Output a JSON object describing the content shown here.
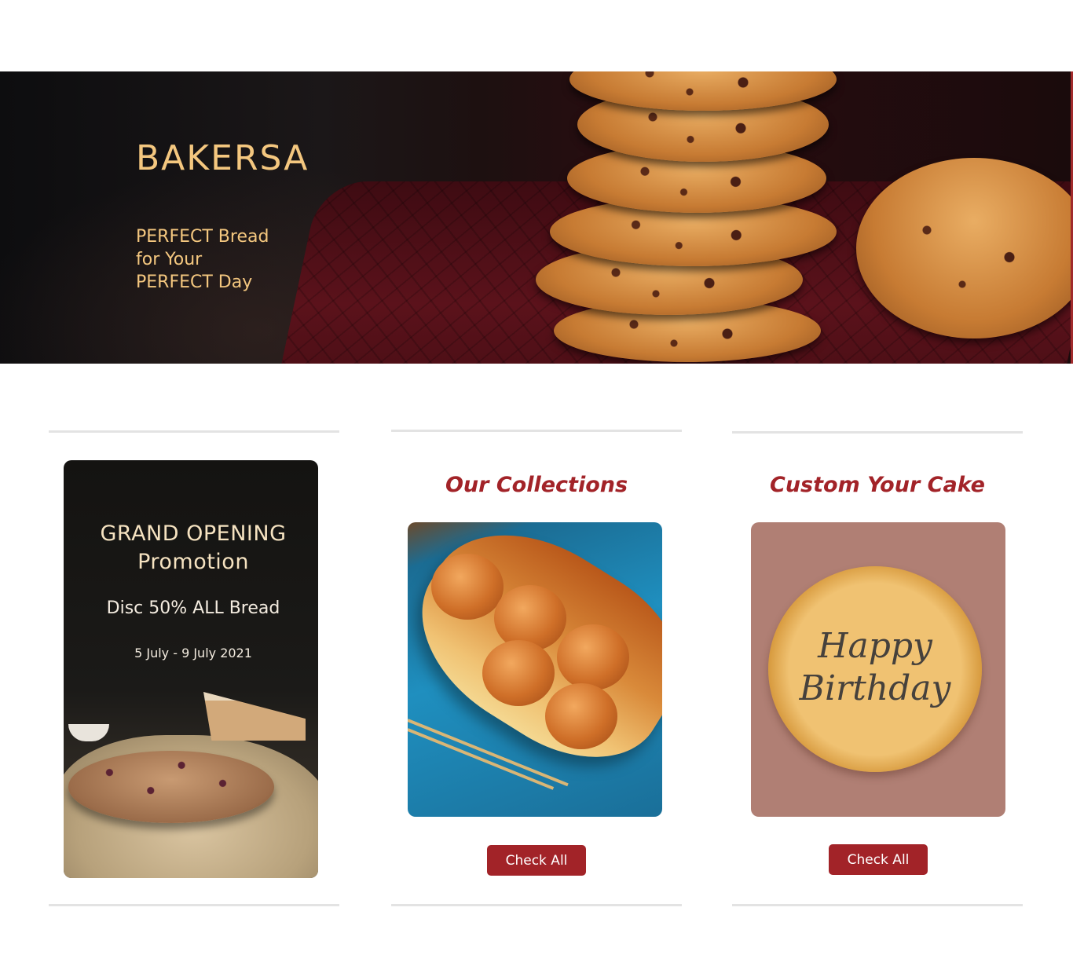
{
  "hero": {
    "brand": "BAKERSA",
    "tagline_line1": "PERFECT Bread",
    "tagline_line2": "for Your",
    "tagline_line3": "PERFECT Day"
  },
  "promo": {
    "heading_line1": "GRAND OPENING",
    "heading_line2": "Promotion",
    "discount": "Disc 50% ALL Bread",
    "dates": "5 July - 9 July 2021"
  },
  "collections": {
    "title": "Our Collections",
    "button_label": "Check All"
  },
  "custom_cake": {
    "title": "Custom Your Cake",
    "cake_text_line1": "Happy",
    "cake_text_line2": "Birthday",
    "button_label": "Check All"
  },
  "colors": {
    "accent": "#a22328",
    "hero_text": "#f4c77f",
    "divider": "#e3e3e3"
  }
}
